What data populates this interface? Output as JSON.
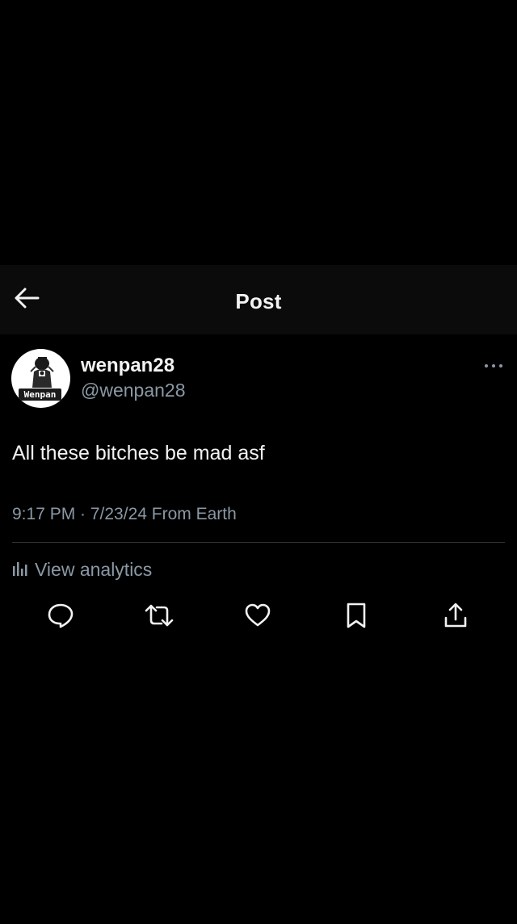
{
  "header": {
    "title": "Post",
    "back_icon": "back-arrow-icon"
  },
  "post": {
    "author": {
      "display_name": "wenpan28",
      "handle": "@wenpan28",
      "avatar_badge": "Wenpan"
    },
    "text": "All these bitches be mad asf",
    "meta": "9:17 PM · 7/23/24 From Earth",
    "analytics_label": "View analytics"
  },
  "actions": [
    {
      "name": "reply",
      "icon": "reply-icon"
    },
    {
      "name": "repost",
      "icon": "repost-icon"
    },
    {
      "name": "like",
      "icon": "heart-icon"
    },
    {
      "name": "bookmark",
      "icon": "bookmark-icon"
    },
    {
      "name": "share",
      "icon": "share-icon"
    }
  ],
  "colors": {
    "background": "#000000",
    "header_background": "#0b0b0b",
    "primary_text": "#f2f2f2",
    "secondary_text": "#8b98a5",
    "divider": "#2f3336"
  }
}
